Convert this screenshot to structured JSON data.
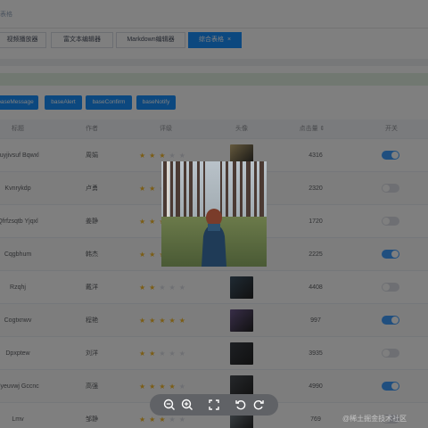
{
  "breadcrumb": "表格",
  "tabs": [
    {
      "label": "视频播放器",
      "active": false
    },
    {
      "label": "富文本编辑器",
      "active": false
    },
    {
      "label": "Markdown编辑器",
      "active": false
    },
    {
      "label": "综合表格",
      "active": true,
      "close": "×"
    }
  ],
  "buttons": [
    "baseMessage",
    "baseAlert",
    "baseConfirm",
    "baseNotify"
  ],
  "table": {
    "headers": {
      "title": "标题",
      "author": "作者",
      "rating": "评级",
      "avatar": "头像",
      "clicks": "点击量",
      "sort_icon": "⇕",
      "toggle": "开关"
    },
    "rows": [
      {
        "title": "Juyjivsuf Bqwxl",
        "author": "周娟",
        "rating": 3,
        "clicks": "4316",
        "on": true,
        "thumb": "#c9b27a"
      },
      {
        "title": "Kvnrykdp",
        "author": "卢勇",
        "rating": 2,
        "clicks": "2320",
        "on": false,
        "thumb": "#6e7d86"
      },
      {
        "title": "Qfrfzsqtb Yjqxl",
        "author": "姜静",
        "rating": 4,
        "clicks": "1720",
        "on": false,
        "thumb": "#4f5b4e"
      },
      {
        "title": "Cqgbhum",
        "author": "韩杰",
        "rating": 3,
        "clicks": "2225",
        "on": true,
        "thumb": "#7a6d56"
      },
      {
        "title": "Rzqhj",
        "author": "戴洋",
        "rating": 2,
        "clicks": "4408",
        "on": false,
        "thumb": "#3f5566"
      },
      {
        "title": "Cogtxnwv",
        "author": "程艳",
        "rating": 5,
        "clicks": "997",
        "on": true,
        "thumb": "#6f5b8f"
      },
      {
        "title": "Dpxptew",
        "author": "刘洋",
        "rating": 2,
        "clicks": "3935",
        "on": false,
        "thumb": "#3b4048"
      },
      {
        "title": "Fyeuvwj Gccnc",
        "author": "高强",
        "rating": 4,
        "clicks": "4990",
        "on": true,
        "thumb": "#4a4f55"
      },
      {
        "title": "Lmv",
        "author": "邹静",
        "rating": 3,
        "clicks": "769",
        "on": false,
        "thumb": "#7e8a93"
      }
    ]
  },
  "viewer": {
    "tools": [
      "zoom-out-icon",
      "zoom-in-icon",
      "fullscreen-icon",
      "rotate-left-icon",
      "rotate-right-icon"
    ]
  },
  "watermark": "@稀土掘金技术社区"
}
